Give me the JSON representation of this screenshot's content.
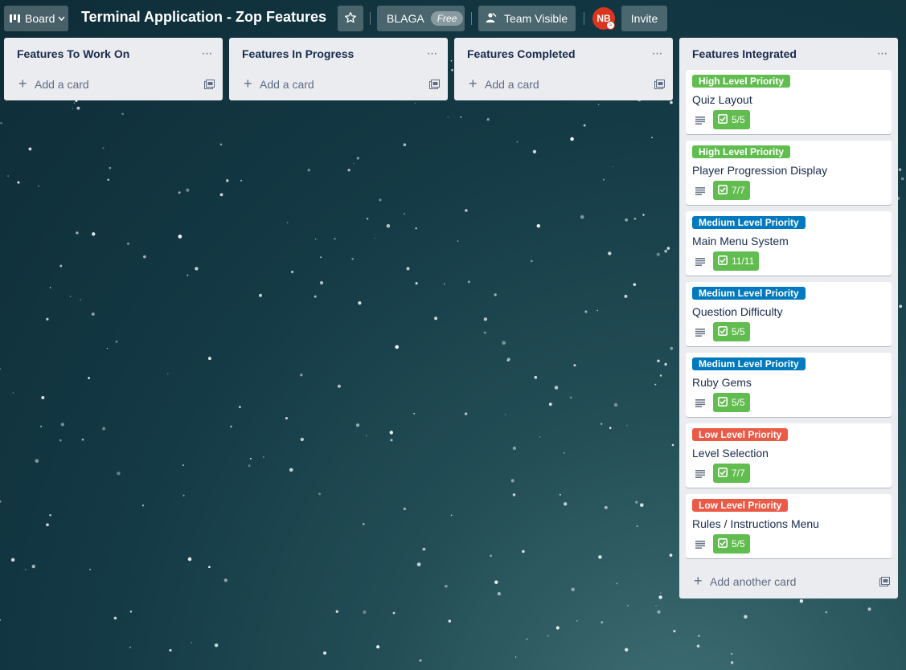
{
  "header": {
    "board_button_label": "Board",
    "board_title": "Terminal Application - Zop Features",
    "team_name": "BLAGA",
    "plan_badge": "Free",
    "visibility_label": "Team Visible",
    "avatar_initials": "NB",
    "invite_label": "Invite"
  },
  "lists": [
    {
      "title": "Features To Work On",
      "add_label": "Add a card"
    },
    {
      "title": "Features In Progress",
      "add_label": "Add a card"
    },
    {
      "title": "Features Completed",
      "add_label": "Add a card"
    },
    {
      "title": "Features Integrated",
      "add_label": "Add another card",
      "cards": [
        {
          "label": "High Level Priority",
          "title": "Quiz Layout",
          "checklist": "5/5"
        },
        {
          "label": "High Level Priority",
          "title": "Player Progression Display",
          "checklist": "7/7"
        },
        {
          "label": "Medium Level Priority",
          "title": "Main Menu System",
          "checklist": "11/11"
        },
        {
          "label": "Medium Level Priority",
          "title": "Question Difficulty",
          "checklist": "5/5"
        },
        {
          "label": "Medium Level Priority",
          "title": "Ruby Gems",
          "checklist": "5/5"
        },
        {
          "label": "Low Level Priority",
          "title": "Level Selection",
          "checklist": "7/7"
        },
        {
          "label": "Low Level Priority",
          "title": "Rules / Instructions Menu",
          "checklist": "5/5"
        }
      ]
    }
  ],
  "colors": {
    "high_priority": "#61bd4f",
    "medium_priority": "#0079bf",
    "low_priority": "#eb5a46",
    "checklist_complete": "#61bd4f",
    "list_background": "#ebecf0"
  }
}
